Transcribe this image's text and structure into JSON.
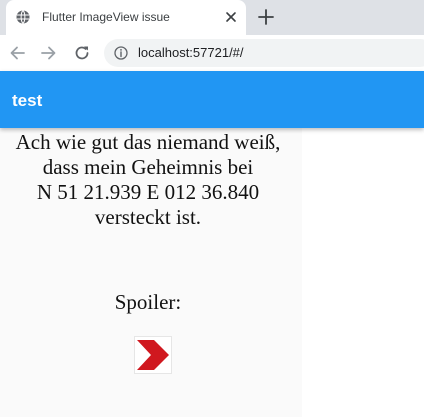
{
  "browser": {
    "tab_title": "Flutter ImageView issue",
    "url": "localhost:57721/#/"
  },
  "icons": {
    "favicon": "globe-icon",
    "tab_close": "close-icon",
    "new_tab": "plus-icon",
    "back": "arrow-left-icon",
    "forward": "arrow-right-icon",
    "reload": "reload-icon",
    "site_info": "info-icon",
    "spoiler": "chevron-right-icon"
  },
  "app": {
    "title": "test",
    "message_lines": [
      "Ach wie gut das niemand weiß,",
      "dass mein Geheimnis bei",
      "N 51 21.939 E 012 36.840",
      "versteckt ist."
    ],
    "spoiler_label": "Spoiler:"
  },
  "colors": {
    "appbar": "#2196f3",
    "tabstrip": "#dee1e6",
    "omnibox": "#f1f3f4",
    "spoiler_red": "#d0181f"
  }
}
